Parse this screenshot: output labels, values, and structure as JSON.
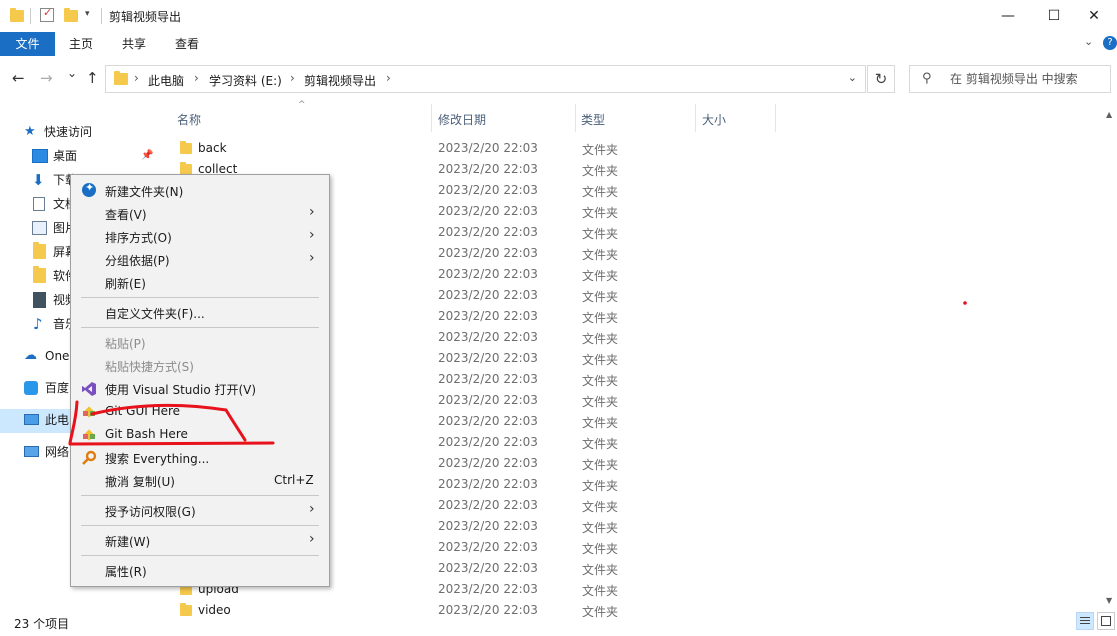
{
  "window": {
    "title": "剪辑视频导出",
    "controls": {
      "minimize": "—",
      "maximize": "☐",
      "close": "✕"
    }
  },
  "ribbon": {
    "tabs": [
      "文件",
      "主页",
      "共享",
      "查看"
    ],
    "help": "?"
  },
  "nav": {
    "back": "←",
    "forward": "→",
    "recent": "⌄",
    "up": "↑",
    "breadcrumb": [
      "此电脑",
      "学习资料 (E:)",
      "剪辑视频导出"
    ],
    "search_placeholder": "在 剪辑视频导出 中搜索"
  },
  "nav_pane": {
    "quick_access": "快速访问",
    "items": [
      "桌面",
      "下载",
      "文档",
      "图片",
      "屏幕",
      "软件",
      "视频",
      "音乐"
    ],
    "onedrive": "One",
    "baidu": "百度",
    "this_pc": "此电",
    "network": "网络"
  },
  "columns": {
    "name": "名称",
    "date": "修改日期",
    "type": "类型",
    "size": "大小"
  },
  "files": {
    "visible_names": [
      "back",
      "collect",
      "upload",
      "video"
    ],
    "date": "2023/2/20 22:03",
    "type": "文件夹"
  },
  "status": {
    "count": "23 个项目"
  },
  "context_menu": {
    "items": [
      {
        "label": "新建文件夹(N)",
        "icon": "new-folder-icon"
      },
      {
        "label": "查看(V)",
        "submenu": true
      },
      {
        "label": "排序方式(O)",
        "submenu": true
      },
      {
        "label": "分组依据(P)",
        "submenu": true
      },
      {
        "label": "刷新(E)"
      },
      {
        "label": "自定义文件夹(F)..."
      },
      {
        "label": "粘贴(P)",
        "disabled": true
      },
      {
        "label": "粘贴快捷方式(S)",
        "disabled": true
      },
      {
        "label": "使用 Visual Studio 打开(V)",
        "icon": "visual-studio-icon"
      },
      {
        "label": "Git GUI Here",
        "icon": "git-gui-icon"
      },
      {
        "label": "Git Bash Here",
        "icon": "git-bash-icon"
      },
      {
        "label": "搜索 Everything...",
        "icon": "everything-search-icon"
      },
      {
        "label": "撤消 复制(U)",
        "shortcut": "Ctrl+Z"
      },
      {
        "label": "授予访问权限(G)",
        "submenu": true
      },
      {
        "label": "新建(W)",
        "submenu": true
      },
      {
        "label": "属性(R)"
      }
    ],
    "submenu_arrow": "›"
  },
  "colors": {
    "accent": "#1a6fc4",
    "selection": "#cce8ff",
    "annotation": "#e8121c",
    "folder": "#f5c94c"
  }
}
